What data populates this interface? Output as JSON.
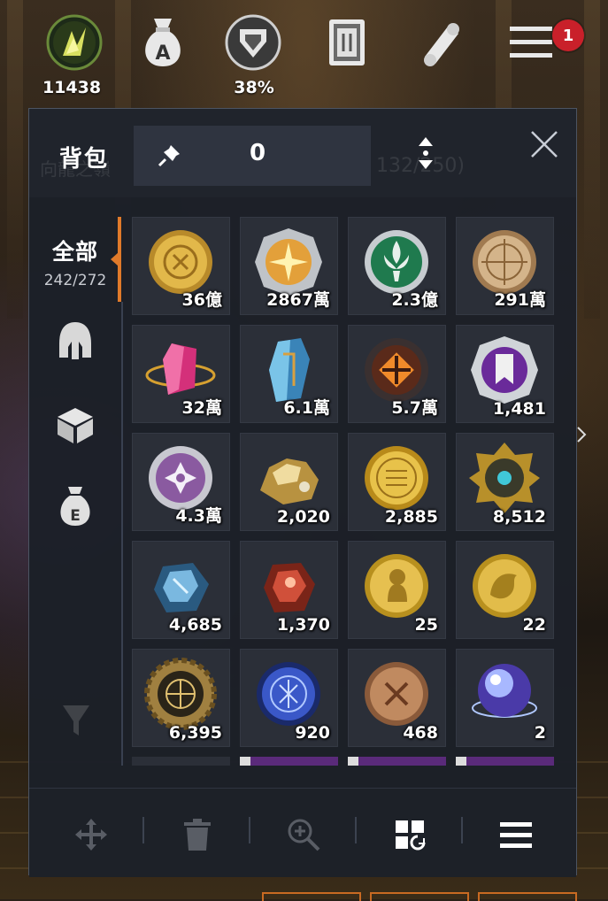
{
  "hud": {
    "power_value": "11438",
    "armor_percent": "38%",
    "menu_badge": "1",
    "icons": [
      "feather-emblem-icon",
      "money-bag-a-icon",
      "armor-shield-icon",
      "card-book-icon",
      "scroll-icon",
      "menu-icon"
    ]
  },
  "panel": {
    "title": "背包",
    "search_value": "0",
    "header_ghost_text": "向龍之嶺",
    "header_ghost_count": "132/250)"
  },
  "sidebar": {
    "all_label": "全部",
    "all_count": "242/272",
    "icons": [
      "helmet-icon",
      "box-icon",
      "money-bag-e-icon",
      "filter-icon"
    ]
  },
  "items": [
    {
      "icon": "gold-coin-icon",
      "qty": "36億"
    },
    {
      "icon": "silver-star-coin-icon",
      "qty": "2867萬"
    },
    {
      "icon": "green-fleur-coin-icon",
      "qty": "2.3億"
    },
    {
      "icon": "bronze-sun-coin-icon",
      "qty": "291萬"
    },
    {
      "icon": "pink-crystal-icon",
      "qty": "32萬"
    },
    {
      "icon": "blue-crystal-icon",
      "qty": "6.1萬"
    },
    {
      "icon": "dark-fire-coin-icon",
      "qty": "5.7萬"
    },
    {
      "icon": "purple-banner-coin-icon",
      "qty": "1,481"
    },
    {
      "icon": "silver-flower-coin-icon",
      "qty": "4.3萬"
    },
    {
      "icon": "gold-ore-icon",
      "qty": "2,020"
    },
    {
      "icon": "engraved-gold-coin-icon",
      "qty": "2,885"
    },
    {
      "icon": "ornate-emblem-icon",
      "qty": "8,512"
    },
    {
      "icon": "blue-gem-icon",
      "qty": "4,685"
    },
    {
      "icon": "red-gem-icon",
      "qty": "1,370"
    },
    {
      "icon": "portrait-gold-coin-icon",
      "qty": "25"
    },
    {
      "icon": "lion-gold-coin-icon",
      "qty": "22"
    },
    {
      "icon": "gear-medallion-icon",
      "qty": "6,395"
    },
    {
      "icon": "blue-rune-coin-icon",
      "qty": "920"
    },
    {
      "icon": "copper-coin-icon",
      "qty": "468"
    },
    {
      "icon": "purple-orb-icon",
      "qty": "2"
    }
  ],
  "toolbar": {
    "icons": [
      "move-icon",
      "trash-icon",
      "zoom-icon",
      "grid-sort-icon",
      "list-icon"
    ]
  },
  "colors": {
    "accent": "#e07a2a",
    "badge": "#c9202a",
    "panel_bg": "#1c2028",
    "cell_bg": "#2b2f38"
  }
}
